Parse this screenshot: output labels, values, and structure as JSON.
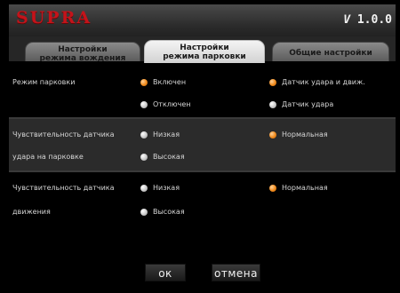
{
  "brand": {
    "logo": "SUPRA",
    "version_prefix": "V",
    "version_number": "1.0.0"
  },
  "tabs": [
    {
      "line1": "Настройки",
      "line2": "режима вождения",
      "active": false
    },
    {
      "line1": "Настройки",
      "line2": "режима парковки",
      "active": true
    },
    {
      "line1": "Общие настройки",
      "line2": "",
      "active": false
    }
  ],
  "parking_mode": {
    "label": "Режим парковки",
    "options": [
      {
        "label": "Включен",
        "selected": true
      },
      {
        "label": "Отключен",
        "selected": false
      },
      {
        "label": "Датчик удара и движ.",
        "selected": true
      },
      {
        "label": "Датчик удара",
        "selected": false
      }
    ]
  },
  "shock_sensitivity": {
    "label_line1": "Чувствительность датчика",
    "label_line2": "удара на парковке",
    "options": [
      {
        "label": "Низкая",
        "selected": false
      },
      {
        "label": "Высокая",
        "selected": false
      },
      {
        "label": "Нормальная",
        "selected": true
      }
    ]
  },
  "motion_sensitivity": {
    "label_line1": "Чувствительность датчика",
    "label_line2": "движения",
    "options": [
      {
        "label": "Низкая",
        "selected": false
      },
      {
        "label": "Высокая",
        "selected": false
      },
      {
        "label": "Нормальная",
        "selected": true
      }
    ]
  },
  "buttons": {
    "ok": "ок",
    "cancel": "отмена"
  },
  "colors": {
    "accent": "#f08a1c",
    "brand_red": "#c4131a",
    "background": "#000000"
  }
}
